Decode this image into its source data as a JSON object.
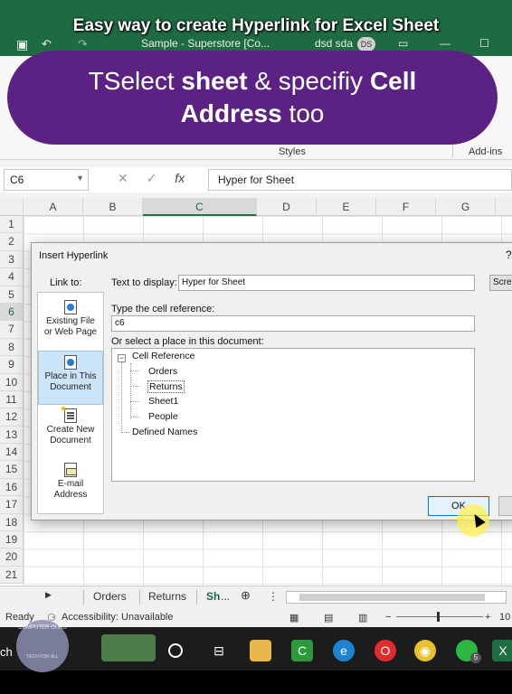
{
  "video_title": "Easy way to create Hyperlink for Excel Sheet",
  "banner": {
    "line1_pre": "TSelect ",
    "line1_bold": "sheet",
    "line1_mid": " & specifiy ",
    "line1_bold2": "Cell",
    "line2_bold": "Address",
    "line2_post": " too"
  },
  "titlebar": {
    "doc_title": "Sample - Superstore  [Co...",
    "user_name": "dsd sda",
    "user_initials": "DS"
  },
  "ribbon": {
    "group_styles": "Styles",
    "group_addins": "Add-ins"
  },
  "formula_bar": {
    "name_box": "C6",
    "fx": "fx",
    "content": "Hyper for Sheet"
  },
  "grid": {
    "columns": [
      "A",
      "B",
      "C",
      "D",
      "E",
      "F",
      "G"
    ],
    "selected_column": "C",
    "rows": [
      "1",
      "2",
      "3",
      "4",
      "5",
      "6",
      "7",
      "8",
      "9",
      "10",
      "11",
      "12",
      "13",
      "14",
      "15",
      "16",
      "17",
      "18",
      "19",
      "20",
      "21"
    ],
    "selected_row": "6"
  },
  "dialog": {
    "title": "Insert Hyperlink",
    "help": "?",
    "link_to_label": "Link to:",
    "link_to_items": [
      {
        "label_l1": "Existing File",
        "label_l2": "or Web Page",
        "icon": "globe-page-icon"
      },
      {
        "label_l1": "Place in This",
        "label_l2": "Document",
        "icon": "document-icon"
      },
      {
        "label_l1": "Create New",
        "label_l2": "Document",
        "icon": "new-document-icon"
      },
      {
        "label_l1": "E-mail",
        "label_l2": "Address",
        "icon": "email-icon"
      }
    ],
    "active_link_to": "Place in This Document",
    "text_to_display_label": "Text to display:",
    "text_to_display_value": "Hyper for Sheet",
    "screentip_label": "ScreenTip...",
    "cell_ref_label": "Type the cell reference:",
    "cell_ref_value": "c6",
    "place_label": "Or select a place in this document:",
    "tree": {
      "root": "Cell Reference",
      "children": [
        "Orders",
        "Returns",
        "Sheet1",
        "People"
      ],
      "selected": "Returns",
      "other": "Defined Names"
    },
    "ok_label": "OK"
  },
  "sheet_tabs": [
    "Orders",
    "Returns",
    "Sh",
    "..."
  ],
  "status": {
    "ready": "Ready",
    "accessibility": "Accessibility: Unavailable",
    "zoom_minus": "−",
    "zoom_plus": "+",
    "zoom_value": "10"
  },
  "taskbar": {
    "search_fragment": "ch",
    "whatsapp_badge": "5",
    "logo_top": "COMPUTER GURU",
    "logo_bottom": "TECH FOR ALL"
  }
}
